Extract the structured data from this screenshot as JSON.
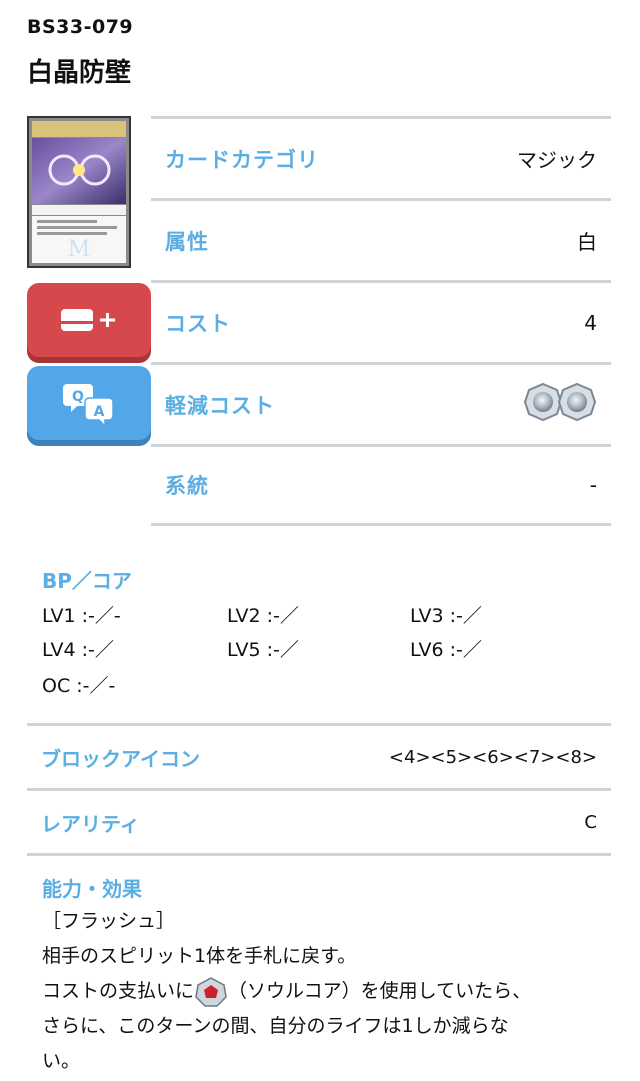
{
  "card": {
    "id": "BS33-079",
    "name": "白晶防壁"
  },
  "details": [
    {
      "label": "カードカテゴリ",
      "value": "マジック"
    },
    {
      "label": "属性",
      "value": "白"
    },
    {
      "label": "コスト",
      "value": "4"
    },
    {
      "label": "軽減コスト",
      "value": "",
      "icon": "white-core-reduction-icon x2"
    },
    {
      "label": "系統",
      "value": "-"
    }
  ],
  "bp_core": {
    "title": "BP／コア",
    "levels": [
      "LV1 :-／-",
      "LV2 :-／",
      "LV3 :-／",
      "LV4 :-／",
      "LV5 :-／",
      "LV6 :-／",
      "OC :-／-"
    ]
  },
  "block_icon": {
    "label": "ブロックアイコン",
    "value": "<4><5><6><7><8>"
  },
  "rarity": {
    "label": "レアリティ",
    "value": "C"
  },
  "effect": {
    "title": "能力・効果",
    "line1": "［フラッシュ］",
    "line2": "相手のスピリット1体を手札に戻す。",
    "line3a": "コストの支払いに",
    "line3b": "（ソウルコア）を使用していたら、",
    "line4": "さらに、このターンの間、自分のライフは1しか減らな",
    "line5": "い。"
  },
  "colors": {
    "accent": "#5aaee3",
    "add_button": "#d7484d",
    "qa_button": "#53a7e8",
    "divider": "#cfd4d8"
  }
}
